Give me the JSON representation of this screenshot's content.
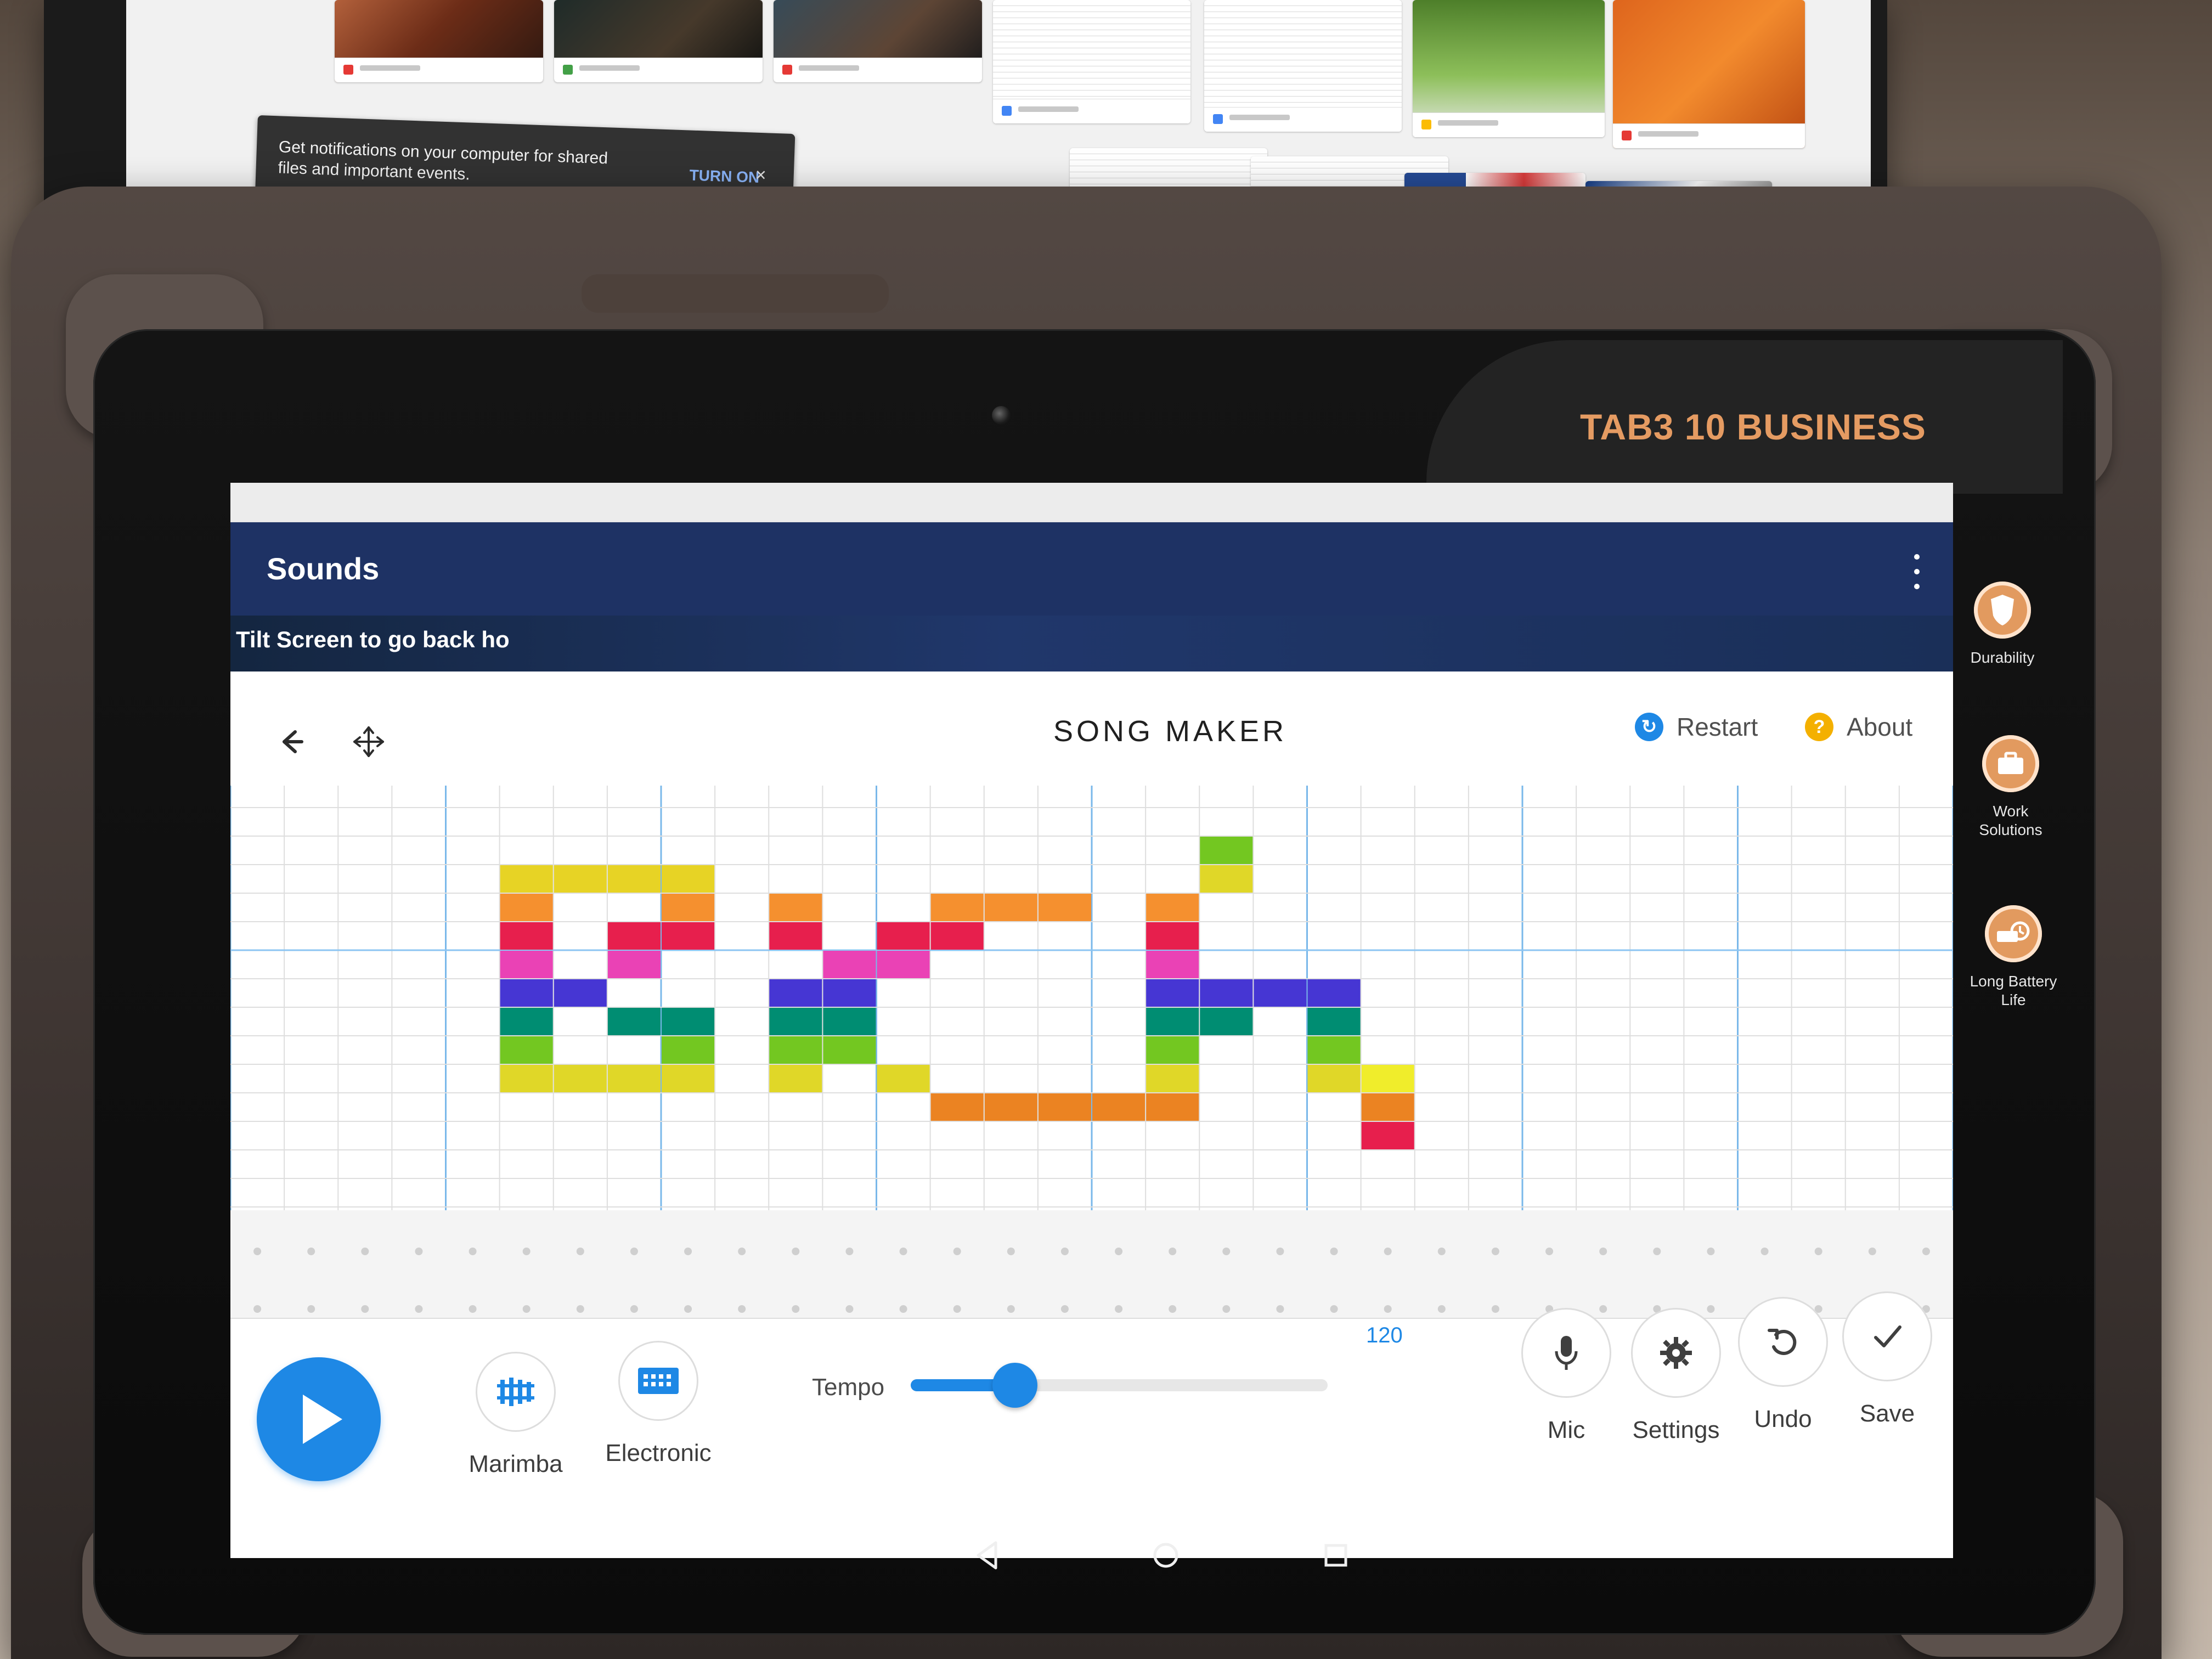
{
  "monitor": {
    "toast_text": "Get notifications on your computer for shared files and important events.",
    "toast_action": "TURN ON"
  },
  "tablet": {
    "brand": "TAB3 10 BUSINESS",
    "side_features": [
      {
        "label": "Durability",
        "icon": "shield-icon"
      },
      {
        "label": "Work Solutions",
        "icon": "briefcase-icon"
      },
      {
        "label": "Long Battery Life",
        "icon": "battery-clock-icon"
      }
    ]
  },
  "app_bar": {
    "title": "Sounds",
    "menu_icon": "more-vertical-icon"
  },
  "overlay": {
    "hint": "Tilt Screen to go back ho"
  },
  "songmaker": {
    "title": "SONG MAKER",
    "restart_label": "Restart",
    "about_label": "About",
    "back_icon": "arrow-left-icon",
    "move_icon": "move-icon",
    "restart_icon": "refresh-icon",
    "about_icon": "help-icon"
  },
  "grid": {
    "columns": 32,
    "melody_rows": 14,
    "percussion_rows": 2,
    "colors": [
      "#e7d325",
      "#f5902f",
      "#e71f4d",
      "#ea42b5",
      "#4636d3",
      "#008d72",
      "#73c721",
      "#e0d728",
      "#eb8322",
      "#f0ed2b"
    ],
    "notes": [
      {
        "c": 5,
        "r": 2,
        "color": "#e7d325"
      },
      {
        "c": 6,
        "r": 2,
        "color": "#e7d325"
      },
      {
        "c": 7,
        "r": 2,
        "color": "#e7d325"
      },
      {
        "c": 8,
        "r": 2,
        "color": "#e7d325"
      },
      {
        "c": 5,
        "r": 3,
        "color": "#f5902f"
      },
      {
        "c": 8,
        "r": 3,
        "color": "#f5902f"
      },
      {
        "c": 5,
        "r": 4,
        "color": "#e71f4d"
      },
      {
        "c": 7,
        "r": 4,
        "color": "#e71f4d"
      },
      {
        "c": 8,
        "r": 4,
        "color": "#e71f4d"
      },
      {
        "c": 5,
        "r": 5,
        "color": "#ea42b5"
      },
      {
        "c": 7,
        "r": 5,
        "color": "#ea42b5"
      },
      {
        "c": 5,
        "r": 6,
        "color": "#4636d3"
      },
      {
        "c": 6,
        "r": 6,
        "color": "#4636d3"
      },
      {
        "c": 5,
        "r": 7,
        "color": "#008d72"
      },
      {
        "c": 7,
        "r": 7,
        "color": "#008d72"
      },
      {
        "c": 8,
        "r": 7,
        "color": "#008d72"
      },
      {
        "c": 5,
        "r": 8,
        "color": "#73c721"
      },
      {
        "c": 8,
        "r": 8,
        "color": "#73c721"
      },
      {
        "c": 5,
        "r": 9,
        "color": "#e0d728"
      },
      {
        "c": 6,
        "r": 9,
        "color": "#e0d728"
      },
      {
        "c": 7,
        "r": 9,
        "color": "#e0d728"
      },
      {
        "c": 8,
        "r": 9,
        "color": "#e0d728"
      },
      {
        "c": 10,
        "r": 3,
        "color": "#f5902f"
      },
      {
        "c": 13,
        "r": 3,
        "color": "#f5902f"
      },
      {
        "c": 14,
        "r": 3,
        "color": "#f5902f"
      },
      {
        "c": 15,
        "r": 3,
        "color": "#f5902f"
      },
      {
        "c": 10,
        "r": 4,
        "color": "#e71f4d"
      },
      {
        "c": 12,
        "r": 4,
        "color": "#e71f4d"
      },
      {
        "c": 13,
        "r": 4,
        "color": "#e71f4d"
      },
      {
        "c": 11,
        "r": 5,
        "color": "#ea42b5"
      },
      {
        "c": 12,
        "r": 5,
        "color": "#ea42b5"
      },
      {
        "c": 10,
        "r": 6,
        "color": "#4636d3"
      },
      {
        "c": 11,
        "r": 6,
        "color": "#4636d3"
      },
      {
        "c": 10,
        "r": 7,
        "color": "#008d72"
      },
      {
        "c": 11,
        "r": 7,
        "color": "#008d72"
      },
      {
        "c": 10,
        "r": 8,
        "color": "#73c721"
      },
      {
        "c": 11,
        "r": 8,
        "color": "#73c721"
      },
      {
        "c": 10,
        "r": 9,
        "color": "#e0d728"
      },
      {
        "c": 12,
        "r": 9,
        "color": "#e0d728"
      },
      {
        "c": 13,
        "r": 10,
        "color": "#eb8322"
      },
      {
        "c": 14,
        "r": 10,
        "color": "#eb8322"
      },
      {
        "c": 15,
        "r": 10,
        "color": "#eb8322"
      },
      {
        "c": 16,
        "r": 10,
        "color": "#eb8322"
      },
      {
        "c": 17,
        "r": 10,
        "color": "#eb8322"
      },
      {
        "c": 18,
        "r": 1,
        "color": "#73c721"
      },
      {
        "c": 18,
        "r": 2,
        "color": "#e0d728"
      },
      {
        "c": 17,
        "r": 3,
        "color": "#f5902f"
      },
      {
        "c": 17,
        "r": 4,
        "color": "#e71f4d"
      },
      {
        "c": 17,
        "r": 5,
        "color": "#ea42b5"
      },
      {
        "c": 17,
        "r": 6,
        "color": "#4636d3"
      },
      {
        "c": 18,
        "r": 6,
        "color": "#4636d3"
      },
      {
        "c": 19,
        "r": 6,
        "color": "#4636d3"
      },
      {
        "c": 20,
        "r": 6,
        "color": "#4636d3"
      },
      {
        "c": 17,
        "r": 7,
        "color": "#008d72"
      },
      {
        "c": 18,
        "r": 7,
        "color": "#008d72"
      },
      {
        "c": 20,
        "r": 7,
        "color": "#008d72"
      },
      {
        "c": 17,
        "r": 8,
        "color": "#73c721"
      },
      {
        "c": 20,
        "r": 8,
        "color": "#73c721"
      },
      {
        "c": 17,
        "r": 9,
        "color": "#e0d728"
      },
      {
        "c": 20,
        "r": 9,
        "color": "#e0d728"
      },
      {
        "c": 21,
        "r": 9,
        "color": "#f0ed2b"
      },
      {
        "c": 21,
        "r": 10,
        "color": "#eb8322"
      },
      {
        "c": 21,
        "r": 11,
        "color": "#e71f4d"
      }
    ]
  },
  "controls": {
    "play_icon": "play-icon",
    "instrument_1": "Marimba",
    "instrument_2": "Electronic",
    "tempo_label": "Tempo",
    "tempo_value": "120",
    "tempo_fraction": 0.25,
    "mic_label": "Mic",
    "settings_label": "Settings",
    "undo_label": "Undo",
    "save_label": "Save"
  },
  "navigation": {
    "back_icon": "android-back-icon",
    "home_icon": "android-home-icon",
    "recents_icon": "android-recents-icon"
  }
}
